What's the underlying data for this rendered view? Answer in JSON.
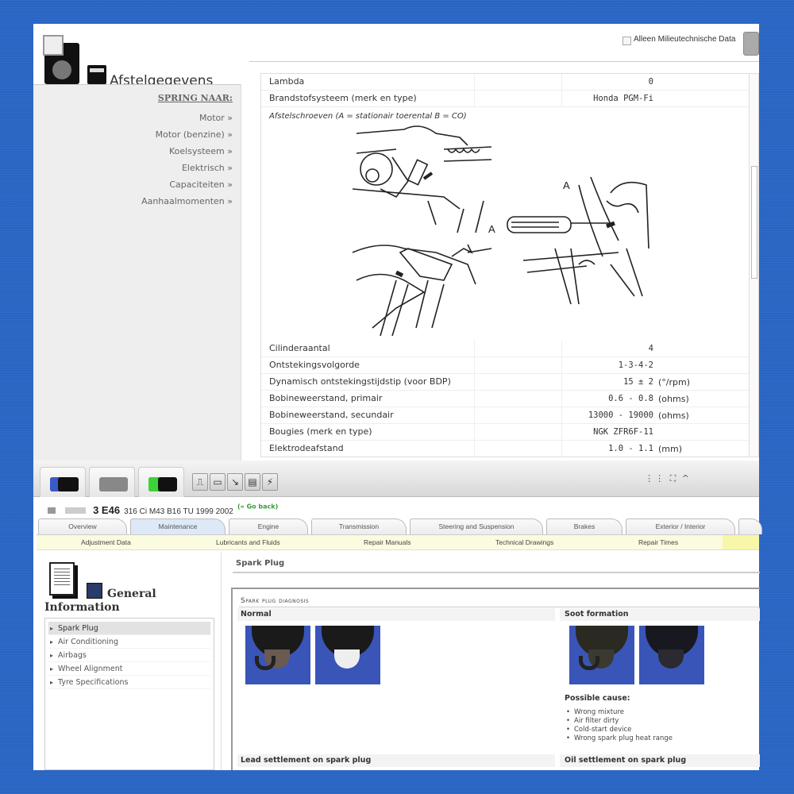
{
  "top_window": {
    "title": "Afstelgegevens",
    "jump_heading": "SPRING NAAR:",
    "jump_items": [
      "Motor »",
      "Motor (benzine) »",
      "Koelsysteem »",
      "Elektrisch »",
      "Capaciteiten »",
      "Aanhaalmomenten »"
    ],
    "filter_label": "Alleen Milieutechnische Data",
    "filter_checked": false,
    "rows_top": [
      {
        "label": "Lambda",
        "value": "0",
        "unit": ""
      },
      {
        "label": "Brandstofsysteem (merk en type)",
        "value": "Honda PGM-Fi",
        "unit": ""
      }
    ],
    "diagram_title": "Afstelschroeven (A = stationair toerental B = CO)",
    "diagram_labels": [
      "A",
      "A"
    ],
    "rows_bottom": [
      {
        "label": "Cilinderaantal",
        "value": "4",
        "unit": ""
      },
      {
        "label": "Ontstekingsvolgorde",
        "value": "1-3-4-2",
        "unit": ""
      },
      {
        "label": "Dynamisch ontstekingstijdstip (voor BDP)",
        "value": "15 ± 2",
        "unit": "(°/rpm)"
      },
      {
        "label": "Bobineweerstand, primair",
        "value": "0.6 - 0.8",
        "unit": "(ohms)"
      },
      {
        "label": "Bobineweerstand, secundair",
        "value": "13000 - 19000",
        "unit": "(ohms)"
      },
      {
        "label": "Bougies (merk en type)",
        "value": "NGK ZFR6F-11",
        "unit": ""
      },
      {
        "label": "Elektrodeafstand",
        "value": "1.0 - 1.1",
        "unit": "(mm)"
      }
    ]
  },
  "bottom_window": {
    "toolbar_tabs": [
      "vehicle-tab",
      "engine-tab",
      "battery-tab"
    ],
    "toolbar_buttons": [
      "⎍",
      "▭",
      "↘",
      "▤",
      "⚡"
    ],
    "toolbar_right": "⋮⋮ ⛶ ^",
    "vehicle": {
      "model": "3 E46",
      "detail": "316 Ci M43 B16 TU 1999 2002",
      "back_link": "(« Go back)"
    },
    "main_tabs": [
      "Overview",
      "Maintenance",
      "Engine",
      "Transmission",
      "Steering and Suspension",
      "Brakes",
      "Exterior / Interior"
    ],
    "active_tab": "Maintenance",
    "subnav": [
      "Adjustment Data",
      "Lubricants and Fluids",
      "Repair Manuals",
      "Technical Drawings",
      "Repair Times"
    ],
    "gi_title_line1": "General",
    "gi_title_line2": "Information",
    "gi_items": [
      "Spark Plug",
      "Air Conditioning",
      "Airbags",
      "Wheel Alignment",
      "Tyre Specifications"
    ],
    "gi_selected": "Spark Plug",
    "content_title": "Spark Plug",
    "diagnosis_heading": "Spark plug diagnosis",
    "sections": {
      "normal": "Normal",
      "soot": "Soot formation",
      "lead": "Lead settlement on spark plug",
      "oil": "Oil settlement on spark plug"
    },
    "possible_cause_title": "Possible cause:",
    "possible_causes": [
      "Wrong mixture",
      "Air filter dirty",
      "Cold-start device",
      "Wrong spark plug heat range"
    ],
    "colors": {
      "photo_bg": "#3a55b8",
      "subnav_bg": "#fbfbe0",
      "active_tab_bg": "#dde9f6",
      "go_back": "#3a9a3a"
    }
  }
}
